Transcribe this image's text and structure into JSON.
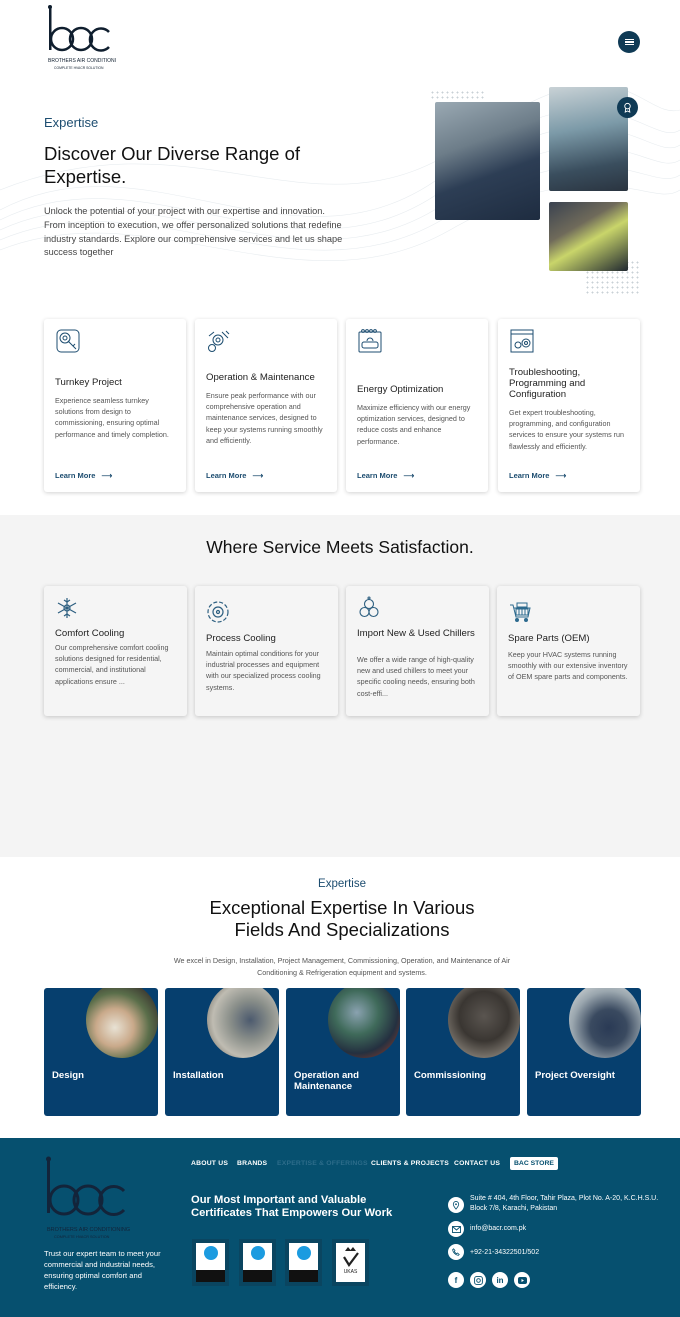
{
  "header": {
    "logo_text": "bac",
    "logo_subtitle": "BROTHERS AIR CONDITIONING",
    "logo_tagline": "COMPLETE HVACR SOLUTION",
    "menu_icon": "hamburger-icon"
  },
  "hero": {
    "kicker": "Expertise",
    "title": "Discover Our Diverse Range of Expertise.",
    "text": "Unlock the potential of your project with our expertise and innovation. From inception to execution, we offer personalized solutions that redefine industry standards. Explore our comprehensive services and let us shape success together",
    "badge_icon": "award-icon"
  },
  "services": [
    {
      "icon": "key-gear-icon",
      "title": "Turnkey Project",
      "text": "Experience seamless turnkey solutions from design to commissioning, ensuring optimal performance and timely completion.",
      "link": "Learn More"
    },
    {
      "icon": "gears-wrench-icon",
      "title": "Operation & Maintenance",
      "text": "Ensure peak performance with our comprehensive operation and maintenance services, designed to keep your systems running smoothly and efficiently.",
      "link": "Learn More"
    },
    {
      "icon": "ac-unit-icon",
      "title": "Energy Optimization",
      "text": "Maximize efficiency with our energy optimization services, designed to reduce costs and enhance performance.",
      "link": "Learn More"
    },
    {
      "icon": "code-settings-icon",
      "title": "Troubleshooting, Programming and Configuration",
      "text": "Get expert troubleshooting, programming, and configuration services to ensure your systems run flawlessly and efficiently.",
      "link": "Learn More"
    }
  ],
  "satisfaction": {
    "title": "Where Service Meets Satisfaction.",
    "items": [
      {
        "icon": "snowflake-icon",
        "title": "Comfort Cooling",
        "text": "Our comprehensive comfort cooling solutions designed for residential, commercial, and institutional applications ensure ..."
      },
      {
        "icon": "fan-cycle-icon",
        "title": "Process Cooling",
        "text": "Maintain optimal conditions for your industrial processes and equipment with our specialized process cooling systems."
      },
      {
        "icon": "chiller-circles-icon",
        "title": "Import New & Used Chillers",
        "text": "We offer a wide range of high-quality new and used chillers to meet your specific cooling needs, ensuring both cost-effi..."
      },
      {
        "icon": "parts-cart-icon",
        "title": "Spare Parts (OEM)",
        "text": "Keep your HVAC systems running smoothly with our extensive inventory of OEM spare parts and components."
      }
    ]
  },
  "expertise": {
    "kicker": "Expertise",
    "title": "Exceptional Expertise In Various Fields And Specializations",
    "text": "We excel in Design, Installation, Project Management, Commissioning, Operation, and Maintenance of Air Conditioning & Refrigeration equipment and systems.",
    "tiles": [
      {
        "label": "Design"
      },
      {
        "label": "Installation"
      },
      {
        "label": "Operation and Maintenance"
      },
      {
        "label": "Commissioning"
      },
      {
        "label": "Project Oversight"
      }
    ]
  },
  "footer": {
    "tagline": "Trust our expert team to meet your commercial and industrial needs, ensuring optimal comfort and efficiency.",
    "nav": [
      "ABOUT US",
      "BRANDS",
      "EXPERTISE & OFFERINGS",
      "CLIENTS & PROJECTS",
      "CONTACT US"
    ],
    "store": "BAC STORE",
    "cert_title": "Our Most Important and Valuable Certificates That Empowers Our Work",
    "certs": [
      {
        "name": "nqa",
        "code": "ISO 9001",
        "label": "QUALITY MANAGEMENT"
      },
      {
        "name": "nqa",
        "code": "ISO 45001",
        "label": "HEALTH & SAFETY MANAGEMENT"
      },
      {
        "name": "nqa",
        "code": "ISO 14001",
        "label": "ENVIRONMENTAL MANAGEMENT"
      },
      {
        "name": "UKAS",
        "code": "015",
        "label": "MANAGEMENT SYSTEMS"
      }
    ],
    "address": "Suite # 404, 4th Floor, Tahir Plaza, Plot No. A-20, K.C.H.S.U. Block 7/8, Karachi, Pakistan",
    "email": "info@bacr.com.pk",
    "phone": "+92-21-34322501/502",
    "social": [
      "facebook-icon",
      "instagram-icon",
      "linkedin-icon",
      "youtube-icon"
    ]
  }
}
